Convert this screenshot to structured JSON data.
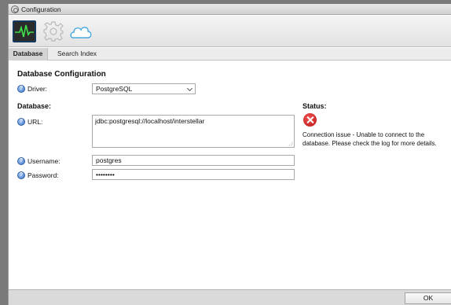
{
  "window": {
    "title": "Configuration"
  },
  "toolbar": {
    "database_icon": "activity-monitor-icon",
    "settings_icon": "gear-icon",
    "cloud_icon": "cloud-icon"
  },
  "tabs": [
    {
      "label": "Database",
      "active": true
    },
    {
      "label": "Search Index",
      "active": false
    }
  ],
  "main": {
    "heading": "Database Configuration",
    "driver": {
      "label": "Driver:",
      "value": "PostgreSQL"
    },
    "database_section": "Database:",
    "url": {
      "label": "URL:",
      "value": "jdbc:postgresql://localhost/interstellar"
    },
    "username": {
      "label": "Username:",
      "value": "postgres"
    },
    "password": {
      "label": "Password:",
      "value": "••••••••"
    },
    "status": {
      "title": "Status:",
      "message": "Connection issue - Unable to connect to the database. Please check the log for more details.",
      "icon": "error-icon",
      "color": "#d32020"
    }
  },
  "footer": {
    "ok_label": "OK"
  }
}
